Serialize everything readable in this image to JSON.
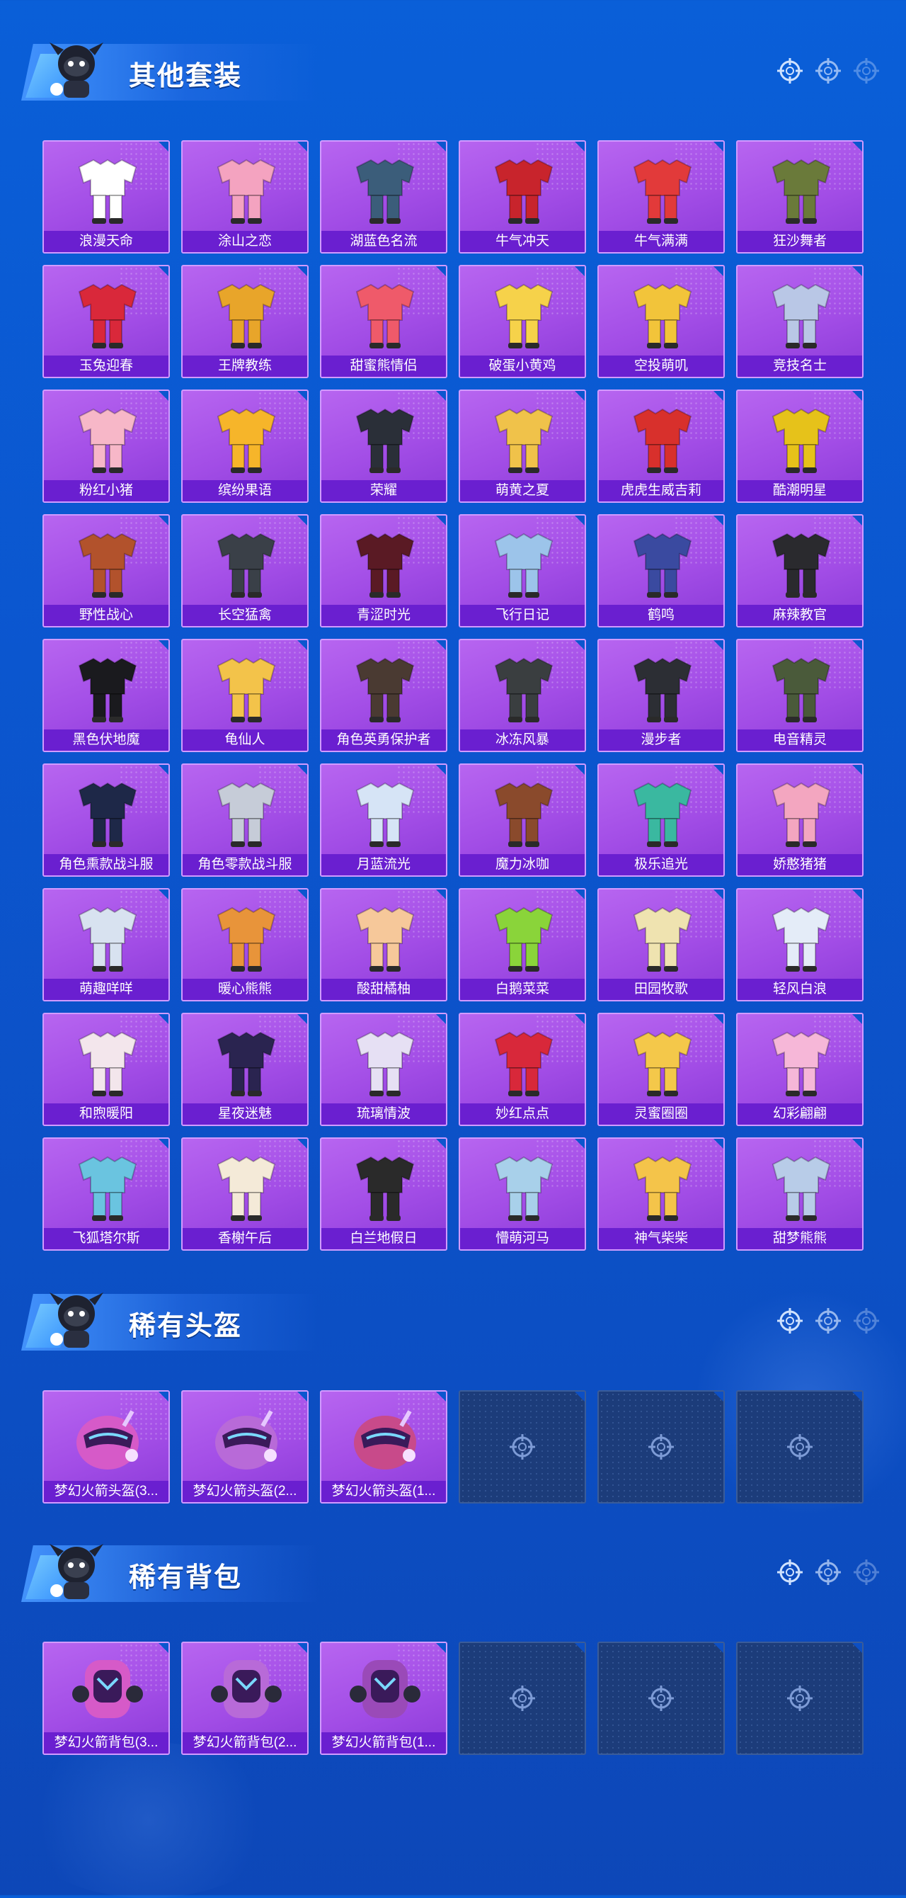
{
  "colors": {
    "bg": "#0b56cf",
    "card": "#a24de6",
    "label_bar": "#6a1fd0",
    "empty_slot": "#1c3c7a"
  },
  "sections": [
    {
      "title": "其他套装",
      "items": [
        {
          "name": "浪漫天命",
          "icon": "outfit-icon",
          "tint": "#ffffff"
        },
        {
          "name": "涂山之恋",
          "icon": "outfit-icon",
          "tint": "#f4a3c0"
        },
        {
          "name": "湖蓝色名流",
          "icon": "outfit-icon",
          "tint": "#3b5d7a"
        },
        {
          "name": "牛气冲天",
          "icon": "outfit-icon",
          "tint": "#c8242c"
        },
        {
          "name": "牛气满满",
          "icon": "outfit-icon",
          "tint": "#e23a3a"
        },
        {
          "name": "狂沙舞者",
          "icon": "outfit-icon",
          "tint": "#6a7a3a"
        },
        {
          "name": "玉兔迎春",
          "icon": "outfit-icon",
          "tint": "#d9283a"
        },
        {
          "name": "王牌教练",
          "icon": "outfit-icon",
          "tint": "#e8a52a"
        },
        {
          "name": "甜蜜熊情侣",
          "icon": "outfit-icon",
          "tint": "#ef5a6a"
        },
        {
          "name": "破蛋小黄鸡",
          "icon": "outfit-icon",
          "tint": "#f6d24a"
        },
        {
          "name": "空投萌叽",
          "icon": "outfit-icon",
          "tint": "#f2c43a"
        },
        {
          "name": "竞技名士",
          "icon": "outfit-icon",
          "tint": "#b9c7e6"
        },
        {
          "name": "粉红小猪",
          "icon": "outfit-icon",
          "tint": "#f7b7c8"
        },
        {
          "name": "缤纷果语",
          "icon": "outfit-icon",
          "tint": "#f6b52a"
        },
        {
          "name": "荣耀",
          "icon": "outfit-icon",
          "tint": "#2a2f38"
        },
        {
          "name": "萌黄之夏",
          "icon": "outfit-icon",
          "tint": "#f0c24a"
        },
        {
          "name": "虎虎生威吉莉",
          "icon": "outfit-icon",
          "tint": "#d8302c"
        },
        {
          "name": "酷潮明星",
          "icon": "outfit-icon",
          "tint": "#e6c21a"
        },
        {
          "name": "野性战心",
          "icon": "outfit-icon",
          "tint": "#b2522c"
        },
        {
          "name": "长空猛禽",
          "icon": "outfit-icon",
          "tint": "#3a4048"
        },
        {
          "name": "青涩时光",
          "icon": "outfit-icon",
          "tint": "#5a1a24"
        },
        {
          "name": "飞行日记",
          "icon": "outfit-icon",
          "tint": "#9cc4ea"
        },
        {
          "name": "鹤鸣",
          "icon": "outfit-icon",
          "tint": "#3a4aa0"
        },
        {
          "name": "麻辣教官",
          "icon": "outfit-icon",
          "tint": "#2a2a2e"
        },
        {
          "name": "黑色伏地魔",
          "icon": "outfit-icon",
          "tint": "#1a1a1e"
        },
        {
          "name": "龟仙人",
          "icon": "outfit-icon",
          "tint": "#f3c34a"
        },
        {
          "name": "角色英勇保护者",
          "icon": "outfit-icon",
          "tint": "#4a3a32"
        },
        {
          "name": "冰冻风暴",
          "icon": "outfit-icon",
          "tint": "#3a3e40"
        },
        {
          "name": "漫步者",
          "icon": "outfit-icon",
          "tint": "#2c2e34"
        },
        {
          "name": "电音精灵",
          "icon": "outfit-icon",
          "tint": "#4a5a3a"
        },
        {
          "name": "角色熏款战斗服",
          "icon": "outfit-icon",
          "tint": "#1e2848"
        },
        {
          "name": "角色零款战斗服",
          "icon": "outfit-icon",
          "tint": "#c6ccd8"
        },
        {
          "name": "月蓝流光",
          "icon": "outfit-icon",
          "tint": "#d6e4f6"
        },
        {
          "name": "魔力冰咖",
          "icon": "outfit-icon",
          "tint": "#8a4a2c"
        },
        {
          "name": "极乐追光",
          "icon": "outfit-icon",
          "tint": "#3ab8a0"
        },
        {
          "name": "娇憨猪猪",
          "icon": "outfit-icon",
          "tint": "#f3a6c0"
        },
        {
          "name": "萌趣咩咩",
          "icon": "outfit-icon",
          "tint": "#d8e2f0"
        },
        {
          "name": "暖心熊熊",
          "icon": "outfit-icon",
          "tint": "#e8943a"
        },
        {
          "name": "酸甜橘柚",
          "icon": "outfit-icon",
          "tint": "#f6c89a"
        },
        {
          "name": "白鹅菜菜",
          "icon": "outfit-icon",
          "tint": "#8ad43a"
        },
        {
          "name": "田园牧歌",
          "icon": "outfit-icon",
          "tint": "#efe3b0"
        },
        {
          "name": "轻风白浪",
          "icon": "outfit-icon",
          "tint": "#e4ecf8"
        },
        {
          "name": "和煦暖阳",
          "icon": "outfit-icon",
          "tint": "#f3e6ec"
        },
        {
          "name": "星夜迷魅",
          "icon": "outfit-icon",
          "tint": "#2a2450"
        },
        {
          "name": "琉璃情波",
          "icon": "outfit-icon",
          "tint": "#e6e0f4"
        },
        {
          "name": "妙红点点",
          "icon": "outfit-icon",
          "tint": "#d8283a"
        },
        {
          "name": "灵蜜圈圈",
          "icon": "outfit-icon",
          "tint": "#f4c84a"
        },
        {
          "name": "幻彩翩翩",
          "icon": "outfit-icon",
          "tint": "#f6b7d8"
        },
        {
          "name": "飞狐塔尔斯",
          "icon": "outfit-icon",
          "tint": "#6ac4e0"
        },
        {
          "name": "香榭午后",
          "icon": "outfit-icon",
          "tint": "#f4ead8"
        },
        {
          "name": "白兰地假日",
          "icon": "outfit-icon",
          "tint": "#2a2a2a"
        },
        {
          "name": "懵萌河马",
          "icon": "outfit-icon",
          "tint": "#a8d0ea"
        },
        {
          "name": "神气柴柴",
          "icon": "outfit-icon",
          "tint": "#f4c44a"
        },
        {
          "name": "甜梦熊熊",
          "icon": "outfit-icon",
          "tint": "#b8cce8"
        }
      ],
      "empty_slots": 0
    },
    {
      "title": "稀有头盔",
      "items": [
        {
          "name": "梦幻火箭头盔(3...",
          "icon": "helmet-icon",
          "tint": "#d65ac8"
        },
        {
          "name": "梦幻火箭头盔(2...",
          "icon": "helmet-icon",
          "tint": "#b86ad8"
        },
        {
          "name": "梦幻火箭头盔(1...",
          "icon": "helmet-icon",
          "tint": "#c84a8a"
        }
      ],
      "empty_slots": 3
    },
    {
      "title": "稀有背包",
      "items": [
        {
          "name": "梦幻火箭背包(3...",
          "icon": "backpack-icon",
          "tint": "#d65ac8"
        },
        {
          "name": "梦幻火箭背包(2...",
          "icon": "backpack-icon",
          "tint": "#b86ad8"
        },
        {
          "name": "梦幻火箭背包(1...",
          "icon": "backpack-icon",
          "tint": "#9a4ab8"
        }
      ],
      "empty_slots": 3
    }
  ]
}
